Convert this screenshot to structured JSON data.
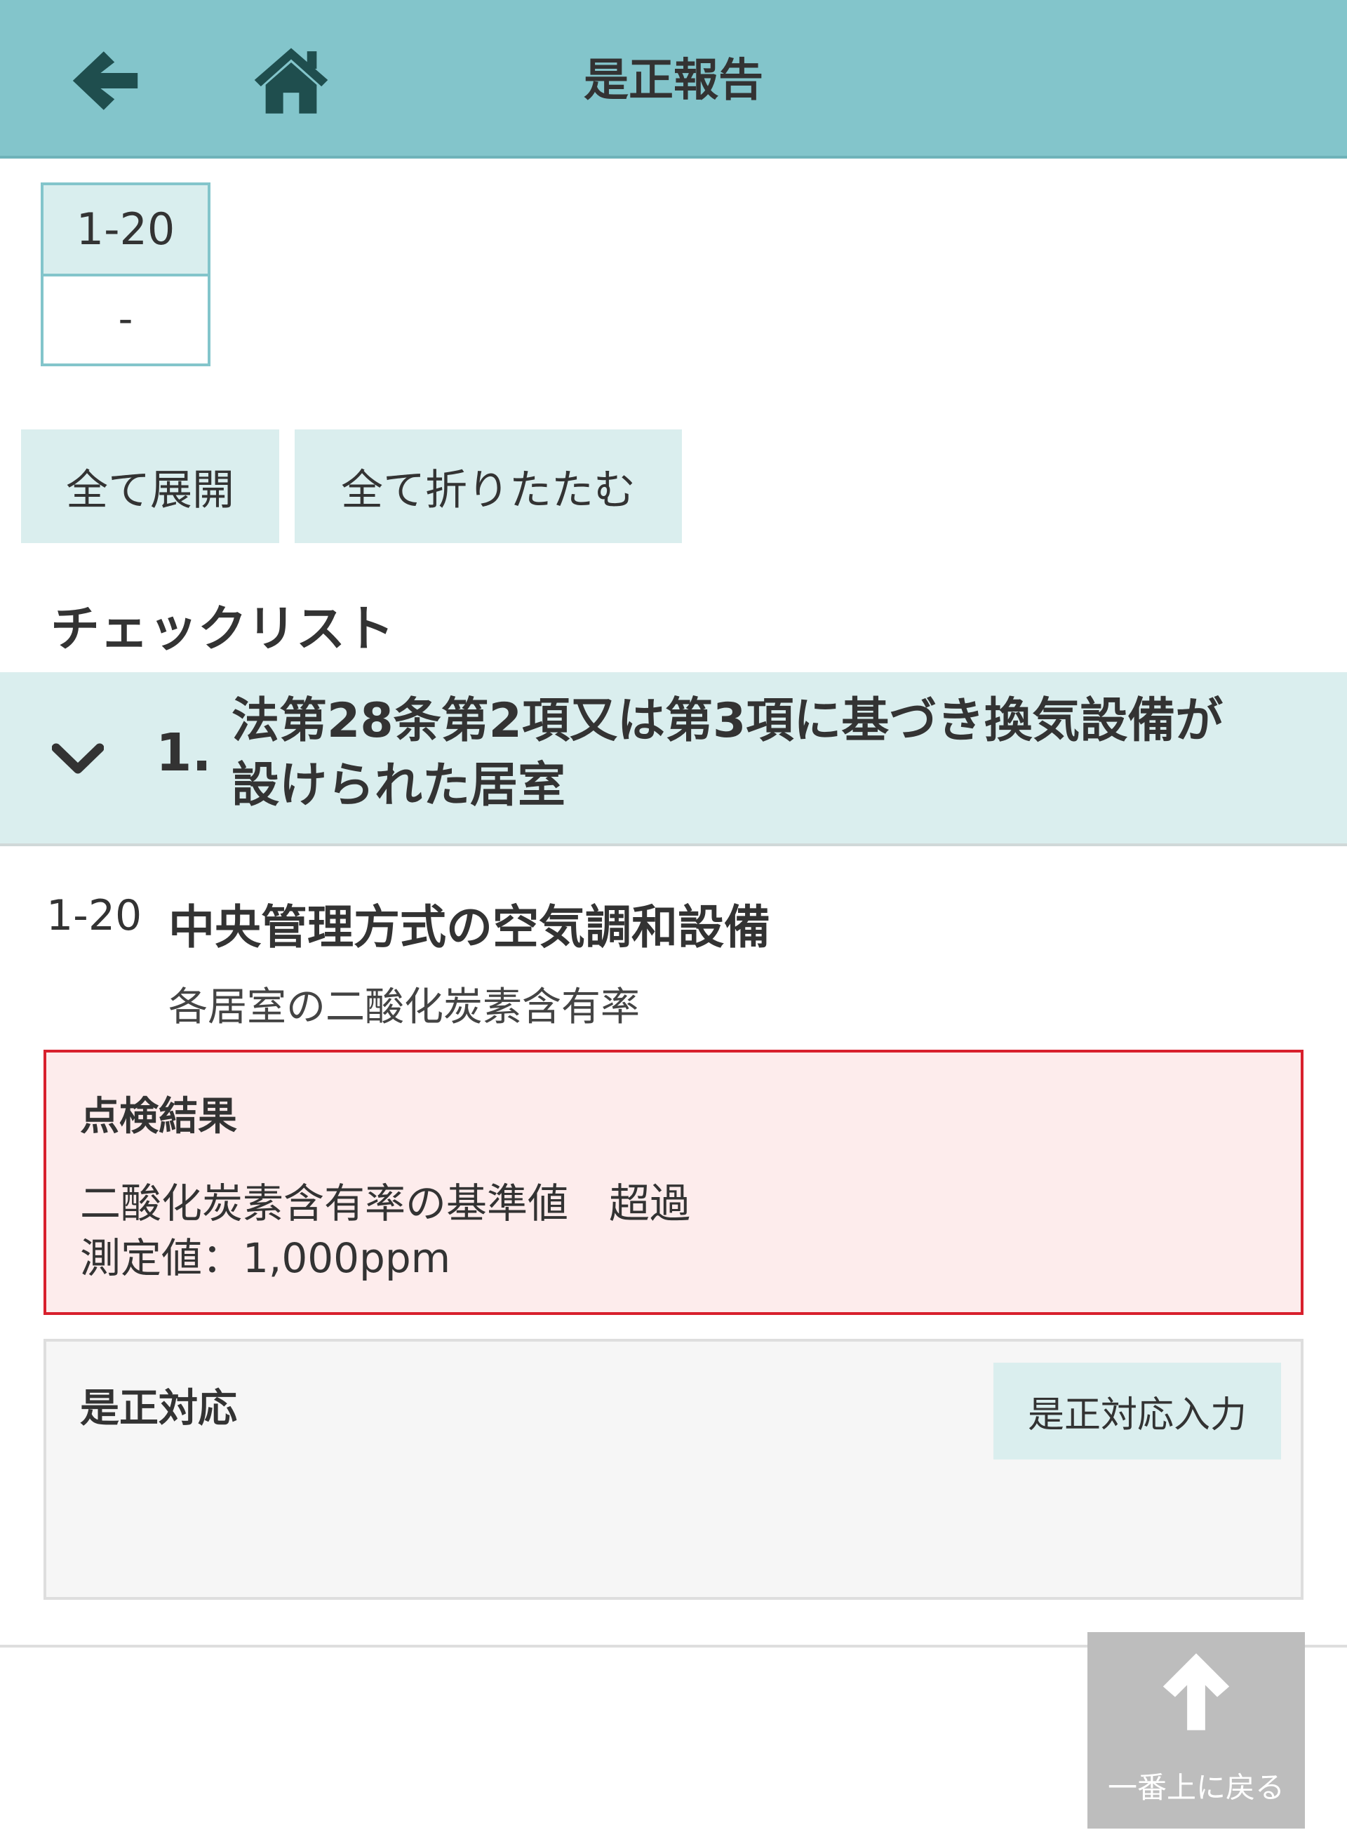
{
  "header": {
    "title": "是正報告",
    "back_icon": "arrow-left-icon",
    "home_icon": "home-icon",
    "background": "#83c5cb"
  },
  "number_box": {
    "top": "1-20",
    "bottom": "-"
  },
  "toolbar": {
    "expand_all": "全て展開",
    "collapse_all": "全て折りたたむ"
  },
  "checklist": {
    "heading": "チェックリスト",
    "section": {
      "number": "1.",
      "title": "法第28条第2項又は第3項に基づき換気設備が設けられた居室"
    },
    "item": {
      "code": "1-20",
      "title": "中央管理方式の空気調和設備",
      "subtitle": "各居室の二酸化炭素含有率"
    }
  },
  "inspection_result": {
    "label": "点検結果",
    "line1": "二酸化炭素含有率の基準値　超過",
    "line2": "測定値：1,000ppm",
    "border_color": "#d8202d"
  },
  "corrective_action": {
    "label": "是正対応",
    "input_button": "是正対応入力"
  },
  "back_to_top": {
    "label": "一番上に戻る",
    "icon": "arrow-up-icon"
  }
}
